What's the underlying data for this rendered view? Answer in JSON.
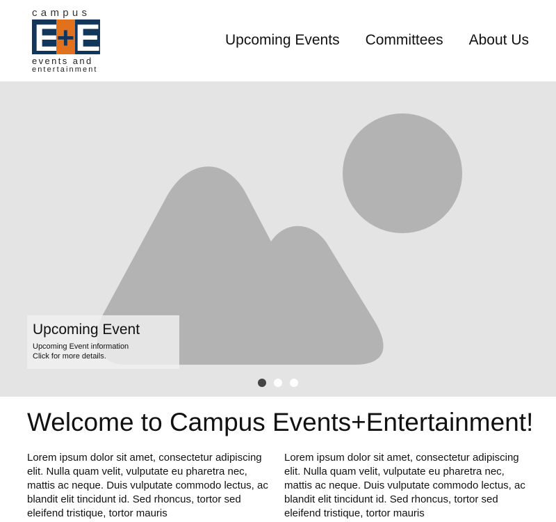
{
  "logo": {
    "top_text": "campus",
    "mark_e1": "E",
    "mark_plus": "+",
    "mark_e2": "E",
    "sub1": "events and",
    "sub2": "entertainment",
    "colors": {
      "navy": "#12355b",
      "orange": "#e2711d"
    }
  },
  "nav": {
    "items": [
      {
        "label": "Upcoming Events"
      },
      {
        "label": "Committees"
      },
      {
        "label": "About Us"
      }
    ]
  },
  "hero": {
    "caption_title": "Upcoming Event",
    "caption_line1": "Upcoming Event information",
    "caption_line2": "Click for more details.",
    "placeholder_icon": "image-placeholder-icon",
    "active_slide": 1,
    "slide_count": 3
  },
  "main": {
    "title": "Welcome to Campus Events+Entertainment!",
    "col1": "Lorem ipsum dolor sit amet, consectetur adipiscing elit. Nulla quam velit, vulputate eu pharetra nec, mattis ac neque. Duis vulputate commodo lectus, ac blandit elit tincidunt id. Sed rhoncus, tortor sed eleifend tristique, tortor mauris",
    "col2": "Lorem ipsum dolor sit amet, consectetur adipiscing elit. Nulla quam velit, vulputate eu pharetra nec, mattis ac neque. Duis vulputate commodo lectus, ac blandit elit tincidunt id. Sed rhoncus, tortor sed eleifend tristique, tortor mauris"
  }
}
